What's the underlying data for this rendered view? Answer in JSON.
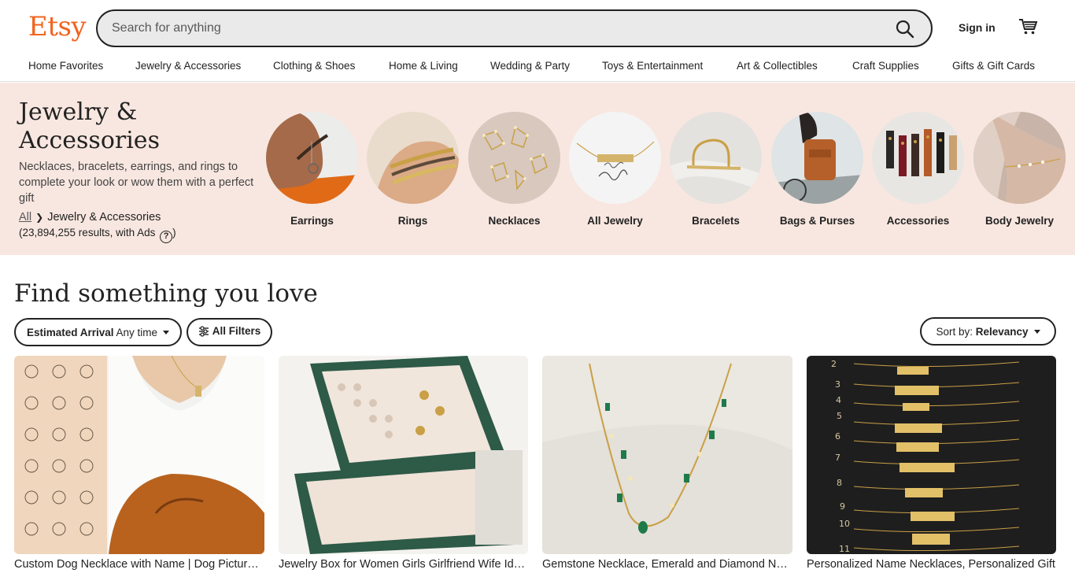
{
  "header": {
    "logo": "Etsy",
    "search_placeholder": "Search for anything",
    "sign_in": "Sign in"
  },
  "nav": [
    "Home Favorites",
    "Jewelry & Accessories",
    "Clothing & Shoes",
    "Home & Living",
    "Wedding & Party",
    "Toys & Entertainment",
    "Art & Collectibles",
    "Craft Supplies",
    "Gifts & Gift Cards"
  ],
  "category": {
    "title": "Jewelry & Accessories",
    "description": "Necklaces, bracelets, earrings, and rings to complete your look or wow them with a perfect gift",
    "breadcrumb_all": "All",
    "breadcrumb_current": "Jewelry & Accessories",
    "results_text": "(23,894,255 results, with Ads",
    "results_close": ")",
    "help_glyph": "?",
    "subcategories": [
      "Earrings",
      "Rings",
      "Necklaces",
      "All Jewelry",
      "Bracelets",
      "Bags & Purses",
      "Accessories",
      "Body Jewelry"
    ]
  },
  "main": {
    "headline": "Find something you love",
    "filter_arrival_label": "Estimated Arrival",
    "filter_arrival_value": "Any time",
    "all_filters": "All Filters",
    "sort_label": "Sort by:",
    "sort_value": "Relevancy"
  },
  "listings": [
    "Custom Dog Necklace with Name | Dog Picture Necklace",
    "Jewelry Box for Women Girls Girlfriend Wife Idea Gift",
    "Gemstone Necklace, Emerald and Diamond Necklace",
    "Personalized Name Necklaces, Personalized Gift"
  ],
  "colors": {
    "brand": "#f1641e",
    "band_bg": "#f8e7e0",
    "text": "#222222"
  }
}
